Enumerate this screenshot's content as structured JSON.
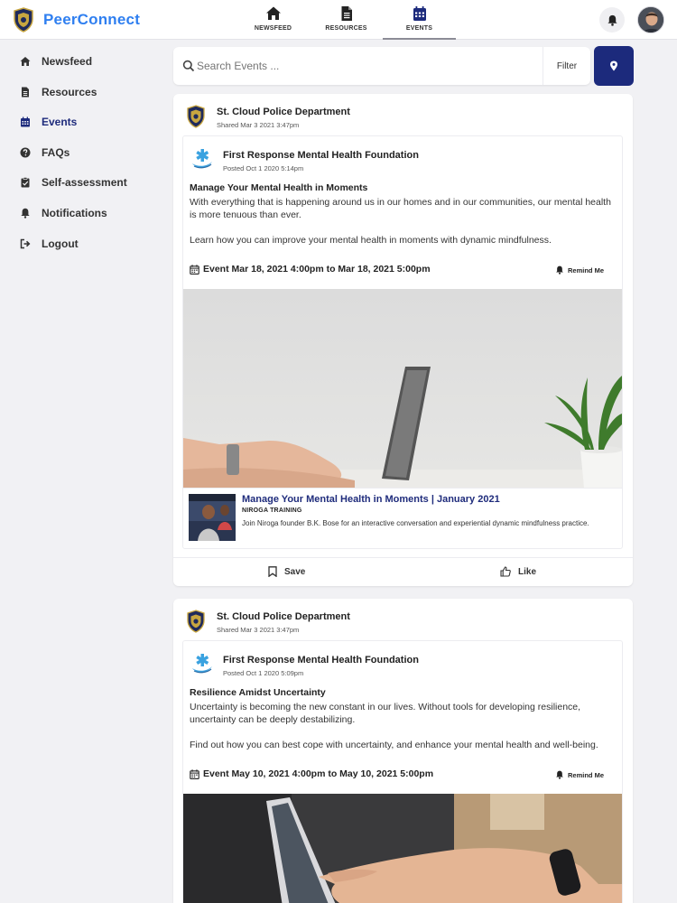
{
  "app": {
    "name": "PeerConnect"
  },
  "nav": {
    "tabs": [
      {
        "label": "NEWSFEED",
        "icon": "home-icon"
      },
      {
        "label": "RESOURCES",
        "icon": "document-icon"
      },
      {
        "label": "EVENTS",
        "icon": "calendar-icon"
      }
    ],
    "active_tab": "EVENTS"
  },
  "sidebar": {
    "items": [
      {
        "label": "Newsfeed",
        "icon": "home-icon"
      },
      {
        "label": "Resources",
        "icon": "document-icon"
      },
      {
        "label": "Events",
        "icon": "calendar-icon"
      },
      {
        "label": "FAQs",
        "icon": "question-circle-icon"
      },
      {
        "label": "Self-assessment",
        "icon": "clipboard-icon"
      },
      {
        "label": "Notifications",
        "icon": "bell-icon"
      },
      {
        "label": "Logout",
        "icon": "logout-icon"
      }
    ],
    "active": "Events"
  },
  "search": {
    "placeholder": "Search Events ...",
    "filter_label": "Filter"
  },
  "colors": {
    "brand": "#2f7ff0",
    "accent": "#1c2a7c",
    "link": "#1f2c7c"
  },
  "posts": [
    {
      "shared_by": "St. Cloud Police Department",
      "shared_date": "Shared Mar 3 2021 3:47pm",
      "org": "First Response Mental Health Foundation",
      "posted": "Posted Oct 1 2020 5:14pm",
      "title": "Manage Your Mental Health in Moments",
      "body1": "With everything that is happening around us in our homes and in our communities, our mental health is more tenuous than ever.",
      "body2": "Learn how you can improve your mental health in moments with dynamic mindfulness.",
      "event": "Event Mar 18, 2021 4:00pm to Mar 18, 2021 5:00pm",
      "remind_label": "Remind Me",
      "link": {
        "title": "Manage Your Mental Health in Moments | January 2021",
        "source": "NIROGA TRAINING",
        "desc": "Join Niroga founder B.K. Bose for an interactive conversation and experiential dynamic mindfulness practice."
      },
      "save_label": "Save",
      "like_label": "Like"
    },
    {
      "shared_by": "St. Cloud Police Department",
      "shared_date": "Shared Mar 3 2021 3:47pm",
      "org": "First Response Mental Health Foundation",
      "posted": "Posted Oct 1 2020 5:09pm",
      "title": "Resilience Amidst Uncertainty",
      "body1": "Uncertainty is becoming the new constant in our lives. Without tools for developing resilience, uncertainty can be deeply destabilizing.",
      "body2": "Find out how you can best cope with uncertainty, and enhance your mental health and well-being.",
      "event": "Event May 10, 2021 4:00pm to May 10, 2021 5:00pm",
      "remind_label": "Remind Me"
    }
  ]
}
